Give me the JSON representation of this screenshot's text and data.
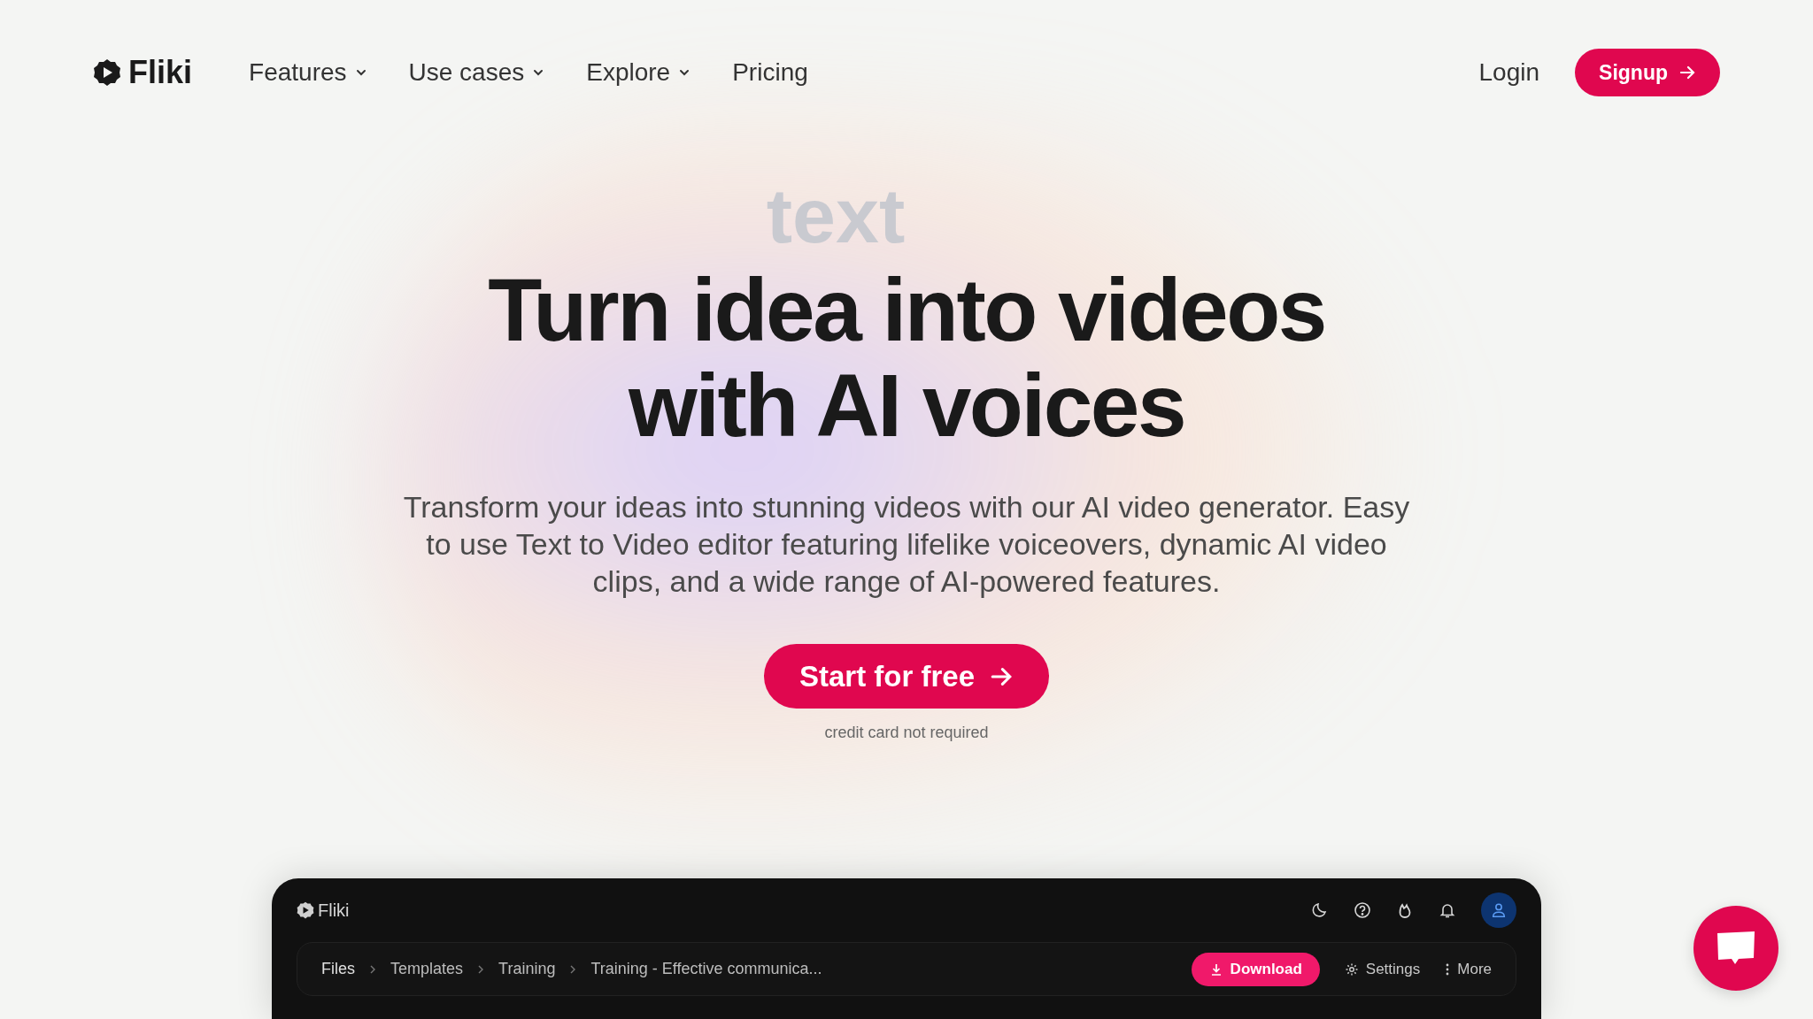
{
  "nav": {
    "logo": "Fliki",
    "items": [
      {
        "label": "Features",
        "dropdown": true
      },
      {
        "label": "Use cases",
        "dropdown": true
      },
      {
        "label": "Explore",
        "dropdown": true
      },
      {
        "label": "Pricing",
        "dropdown": false
      }
    ],
    "login": "Login",
    "signup": "Signup"
  },
  "hero": {
    "rotating_word": "text",
    "headline_lines": [
      "Turn idea into videos",
      "with AI voices"
    ],
    "subtitle": "Transform your ideas into stunning videos with our AI video generator. Easy to use Text to Video editor featuring lifelike voiceovers, dynamic AI video clips, and a wide range of AI-powered features.",
    "cta": "Start for free",
    "note": "credit card not required"
  },
  "app": {
    "logo": "Fliki",
    "breadcrumbs": [
      "Files",
      "Templates",
      "Training",
      "Training - Effective communica..."
    ],
    "actions": [
      {
        "kind": "primary",
        "label": "Download"
      },
      {
        "kind": "settings",
        "label": "Settings"
      },
      {
        "kind": "more",
        "label": "More"
      }
    ]
  }
}
